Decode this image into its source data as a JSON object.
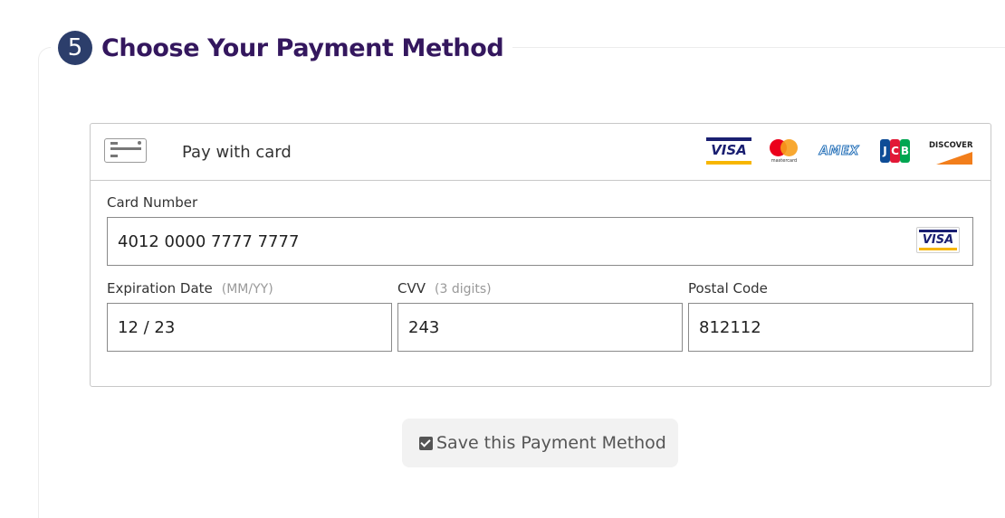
{
  "section": {
    "step_number": "5",
    "title": "Choose Your Payment Method"
  },
  "card_panel": {
    "pay_label": "Pay with card",
    "brands": [
      {
        "name": "VISA",
        "color": "#1a1f71"
      },
      {
        "name": "mastercard",
        "color": "#eb001b"
      },
      {
        "name": "AMEX",
        "color": "#2671b9"
      },
      {
        "name": "JCB",
        "letters": [
          "J",
          "C",
          "B"
        ],
        "colors": [
          "#0e4c96",
          "#e21836",
          "#00a651"
        ]
      },
      {
        "name": "DISCOVER",
        "color": "#f27e1b"
      }
    ],
    "card_number": {
      "label": "Card Number",
      "value": "4012 0000 7777 7777",
      "brand_badge": "VISA"
    },
    "expiration": {
      "label": "Expiration Date",
      "hint": "(MM/YY)",
      "value": "12 / 23"
    },
    "cvv": {
      "label": "CVV",
      "hint": "(3 digits)",
      "value": "243"
    },
    "postal_code": {
      "label": "Postal Code",
      "value": "812112"
    }
  },
  "save_button": {
    "label": "Save this Payment Method",
    "checked": true
  },
  "colors": {
    "title": "#34175e",
    "badge": "#2c3e6b",
    "button_bg": "#f2f2f2"
  }
}
